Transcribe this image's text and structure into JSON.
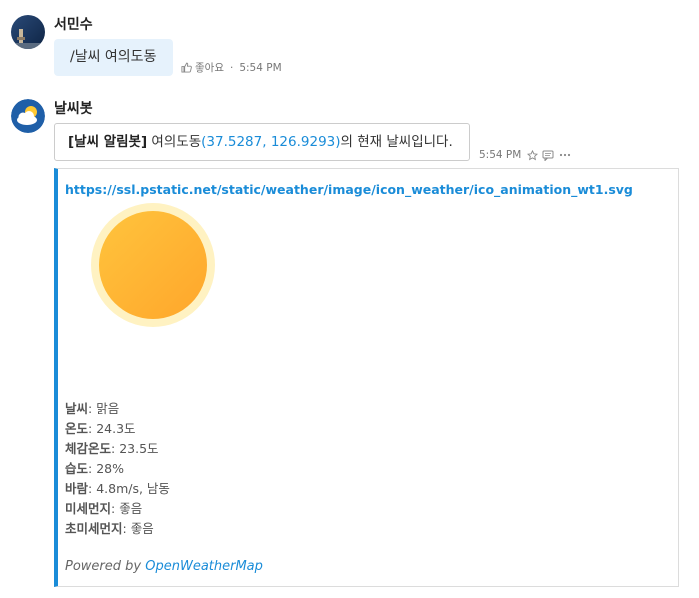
{
  "messages": [
    {
      "sender": "서민수",
      "text": "/날씨 여의도동",
      "like_label": "좋아요",
      "separator": "·",
      "time": "5:54 PM"
    },
    {
      "sender": "날씨봇",
      "text_prefix": "[날씨 알림봇]",
      "text_place": " 여의도동",
      "coord_open": "(",
      "latitude": "37.5287",
      "coord_sep": ", ",
      "longitude": "126.9293",
      "coord_close": ")",
      "text_suffix": "의 현재 날씨입니다.",
      "time": "5:54 PM",
      "icons": [
        "star-icon",
        "comment-icon",
        "more-icon"
      ]
    }
  ],
  "card": {
    "url": "https://ssl.pstatic.net/static/weather/image/icon_weather/ico_animation_wt1.svg",
    "info": [
      {
        "key": "날씨",
        "value": "맑음"
      },
      {
        "key": "온도",
        "value": "24.3도"
      },
      {
        "key": "체감온도",
        "value": "23.5도"
      },
      {
        "key": "습도",
        "value": "28%"
      },
      {
        "key": "바람",
        "value": "4.8m/s, 남동"
      },
      {
        "key": "미세먼지",
        "value": "좋음"
      },
      {
        "key": "초미세먼지",
        "value": "좋음"
      }
    ],
    "powered_by": "Powered by",
    "provider": "OpenWeatherMap"
  },
  "colors": {
    "accent": "#1a8cd8",
    "user_bubble": "#e6f2fc",
    "sun_inner": "#ffb830",
    "sun_outer": "#fff2c2"
  }
}
